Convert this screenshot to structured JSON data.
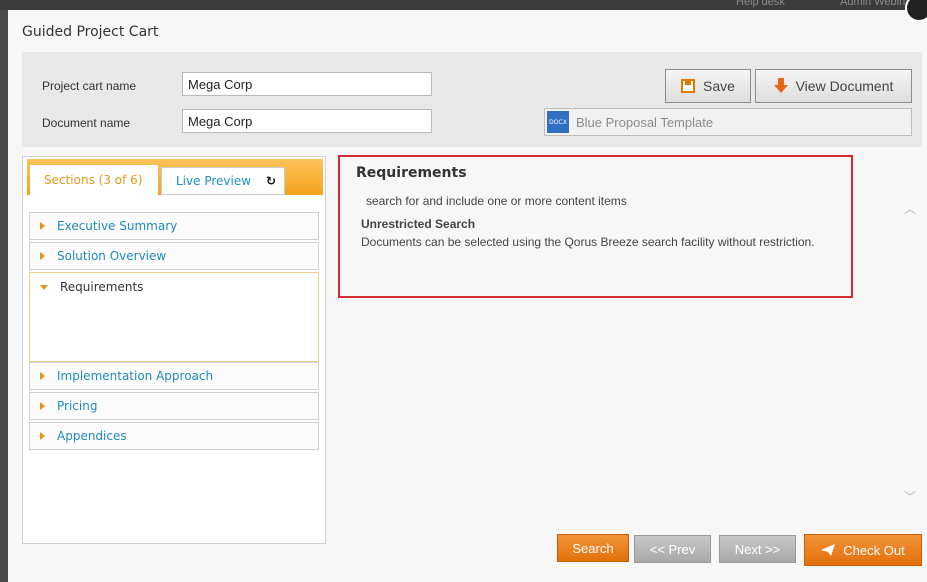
{
  "topbar": {
    "help_desk": "Help desk",
    "admin_webinar": "Admin Webinar"
  },
  "dialog": {
    "title": "Guided Project Cart"
  },
  "form": {
    "project_cart_label": "Project cart name",
    "project_cart_value": "Mega Corp",
    "document_name_label": "Document name",
    "document_name_value": "Mega Corp",
    "save_label": "Save",
    "view_document_label": "View Document",
    "template_name": "Blue Proposal Template",
    "template_icon_text": "DOCX"
  },
  "tabs": {
    "sections": "Sections (3 of 6)",
    "live_preview": "Live Preview"
  },
  "sections": [
    {
      "label": "Executive Summary",
      "expanded": false
    },
    {
      "label": "Solution Overview",
      "expanded": false
    },
    {
      "label": "Requirements",
      "expanded": true
    },
    {
      "label": "Implementation Approach",
      "expanded": false
    },
    {
      "label": "Pricing",
      "expanded": false
    },
    {
      "label": "Appendices",
      "expanded": false
    }
  ],
  "requirements": {
    "title": "Requirements",
    "instruction": "search for and include one or more content items",
    "search_type": "Unrestricted Search",
    "description": "Documents can be selected using the Qorus Breeze search facility without restriction."
  },
  "footer": {
    "search_label": "Search",
    "prev_label": "<< Prev",
    "next_label": "Next >>",
    "checkout_label": "Check Out"
  },
  "colors": {
    "accent_orange": "#f28a1a",
    "link_blue": "#1f8cb6",
    "highlight_red": "#d42b35"
  }
}
